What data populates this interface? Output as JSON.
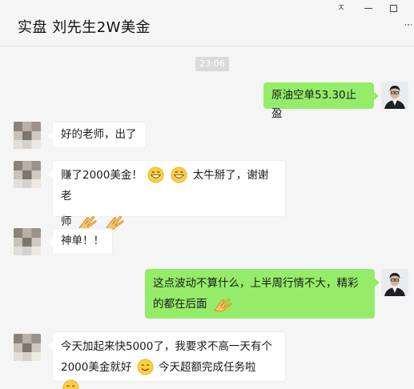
{
  "window": {
    "title": "实盘 刘先生2W美金",
    "pin_glyph": "ㅈ"
  },
  "chat": {
    "timestamp": "23:06",
    "messages": [
      {
        "side": "out",
        "parts": [
          "原油空单53.30止盈"
        ]
      },
      {
        "side": "in",
        "parts": [
          "好的老师，出了"
        ]
      },
      {
        "side": "in",
        "parts": [
          "赚了2000美金！",
          "太牛掰了，谢谢老",
          "师"
        ],
        "emojis": [
          "grin-emoji",
          "grin-emoji",
          "clap-emoji",
          "clap-emoji"
        ]
      },
      {
        "side": "in",
        "parts": [
          "神单！！"
        ]
      },
      {
        "side": "out",
        "parts": [
          "这点波动不算什么，上半周行情不大，精彩",
          "的都在后面"
        ],
        "emojis": [
          "clap-emoji"
        ]
      },
      {
        "side": "in",
        "parts": [
          "今天加起来快5000了，我要求不高一天有个",
          "2000美金就好",
          "今天超额完成任务啦"
        ],
        "emojis": [
          "smile-emoji",
          "tongue-emoji"
        ]
      }
    ]
  },
  "colors": {
    "bubble_out": "#95ec69",
    "bubble_in": "#ffffff",
    "background": "#f5f5f5"
  }
}
